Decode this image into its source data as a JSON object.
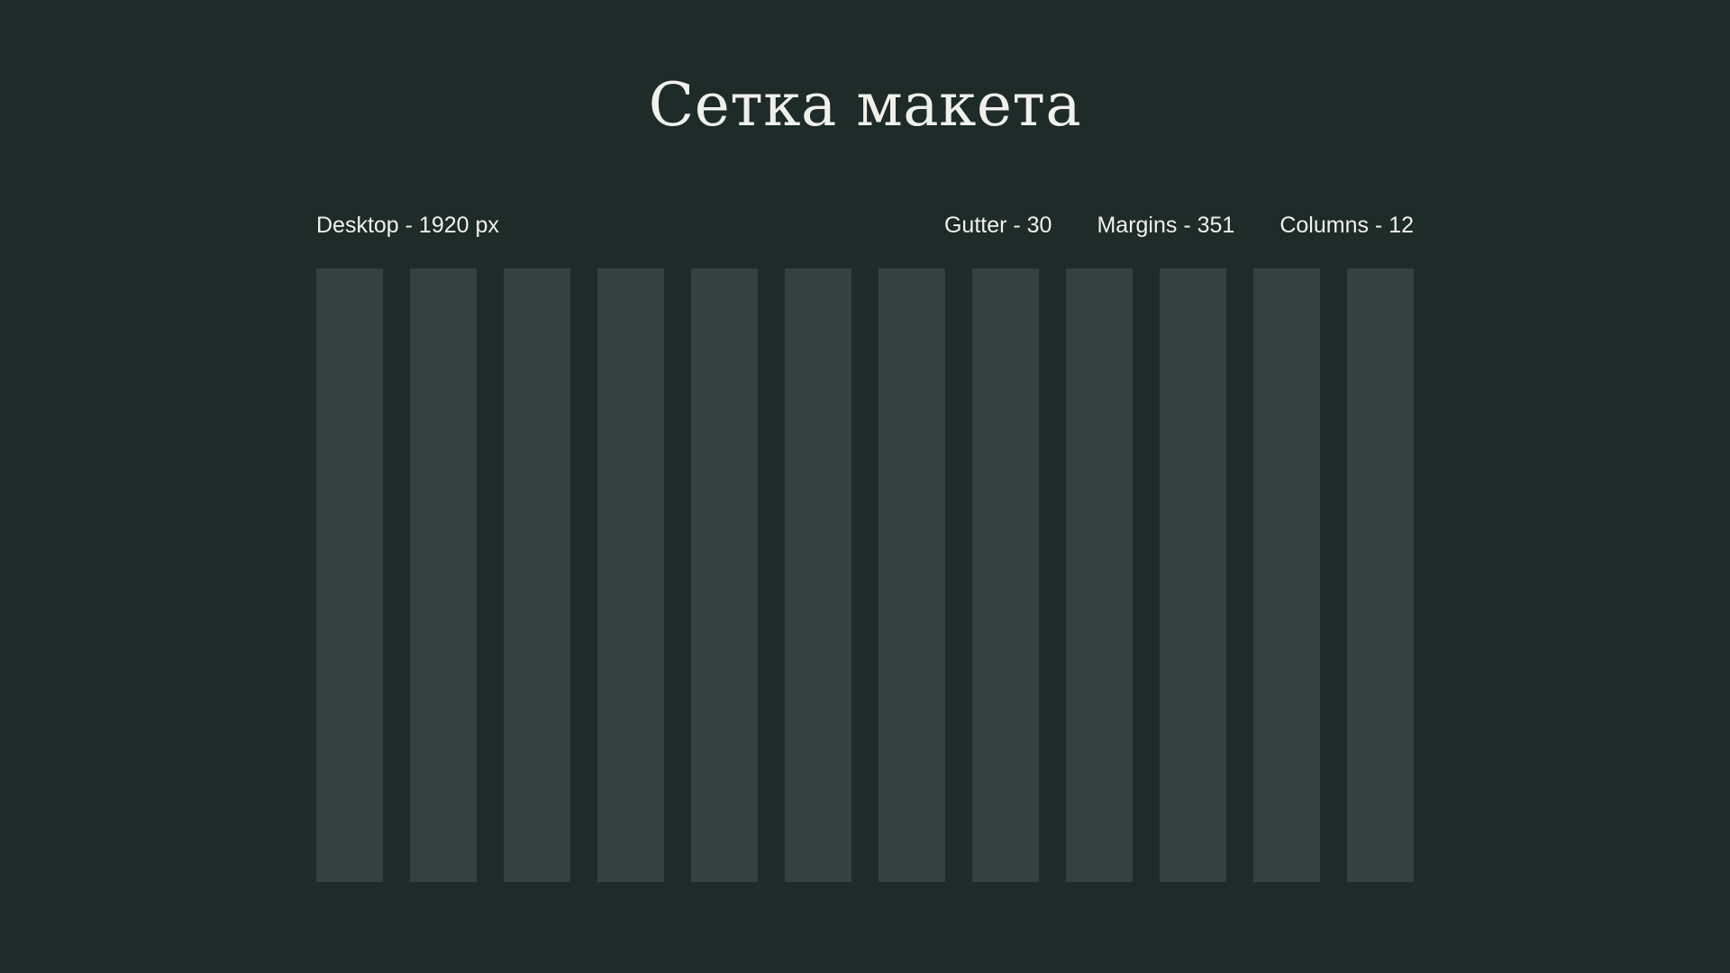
{
  "title": "Сетка макета",
  "meta": {
    "desktop": "Desktop - 1920 px",
    "gutter": "Gutter - 30",
    "margins": "Margins - 351",
    "columns": "Columns - 12"
  },
  "grid": {
    "column_count": 12,
    "column_color": "#34413f"
  },
  "colors": {
    "background": "#1f2b29",
    "text": "#f1f1ec"
  }
}
